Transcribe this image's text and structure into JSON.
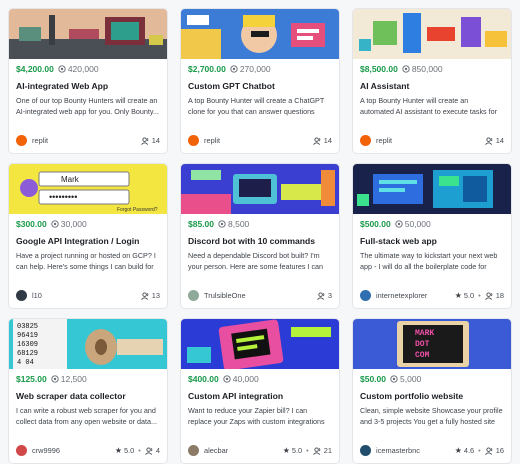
{
  "cards": [
    {
      "price": "$4,200.00",
      "cycles": "420,000",
      "title": "AI-integrated Web App",
      "desc": "One of our top Bounty Hunters will create an AI-integrated web app for you. Only Bounty...",
      "user": "replit",
      "rating": "",
      "apps": "14",
      "avatar_color": "#f26207",
      "thumb": "a"
    },
    {
      "price": "$2,700.00",
      "cycles": "270,000",
      "title": "Custom GPT Chatbot",
      "desc": "A top Bounty Hunter will create a ChatGPT clone for you that can answer questions abo...",
      "user": "replit",
      "rating": "",
      "apps": "14",
      "avatar_color": "#f26207",
      "thumb": "b"
    },
    {
      "price": "$8,500.00",
      "cycles": "850,000",
      "title": "AI Assistant",
      "desc": "A top Bounty Hunter will create an automated AI assistant to execute tasks for you. Some...",
      "user": "replit",
      "rating": "",
      "apps": "14",
      "avatar_color": "#f26207",
      "thumb": "c"
    },
    {
      "price": "$300.00",
      "cycles": "30,000",
      "title": "Google API Integration / Login",
      "desc": "Have a project running or hosted on GCP? I can help. Here's some things I can build for you...",
      "user": "l10",
      "rating": "",
      "apps": "13",
      "avatar_color": "#2f3a44",
      "thumb": "d"
    },
    {
      "price": "$85.00",
      "cycles": "8,500",
      "title": "Discord bot with 10 commands",
      "desc": "Need a dependable Discord bot built? I'm your person. Here are some features I can build in...",
      "user": "TrulsibleOne",
      "rating": "",
      "apps": "3",
      "avatar_color": "#8fa99a",
      "thumb": "e"
    },
    {
      "price": "$500.00",
      "cycles": "50,000",
      "title": "Full-stack web app",
      "desc": "The ultimate way to kickstart your next web app - I will do all the boilerplate code for you...",
      "user": "internetexplorer",
      "rating": "5.0",
      "apps": "18",
      "avatar_color": "#2f6fb0",
      "thumb": "f"
    },
    {
      "price": "$125.00",
      "cycles": "12,500",
      "title": "Web scraper data collector",
      "desc": "I can write a robust web scraper for you and collect data from any open website or data...",
      "user": "crw9996",
      "rating": "5.0",
      "apps": "4",
      "avatar_color": "#d04848",
      "thumb": "g"
    },
    {
      "price": "$400.00",
      "cycles": "40,000",
      "title": "Custom API integration",
      "desc": "Want to reduce your Zapier bill? I can replace your Zaps with custom integrations between...",
      "user": "alecbar",
      "rating": "5.0",
      "apps": "21",
      "avatar_color": "#8a7a66",
      "thumb": "h"
    },
    {
      "price": "$50.00",
      "cycles": "5,000",
      "title": "Custom portfolio website",
      "desc": "Clean, simple website Showcase your profile and 3-5 projects You get a fully hosted site +...",
      "user": "icemasterbnc",
      "rating": "4.6",
      "apps": "16",
      "avatar_color": "#1f4d6b",
      "thumb": "i"
    }
  ],
  "thumb_text": {
    "login_name": "Mark",
    "login_forgot": "Forgot Password?",
    "scraper_digits": [
      "03825",
      "96419",
      "16309",
      "68129",
      "4 04"
    ],
    "portfolio_sign": [
      "MARK",
      "DOT",
      "COM"
    ]
  }
}
